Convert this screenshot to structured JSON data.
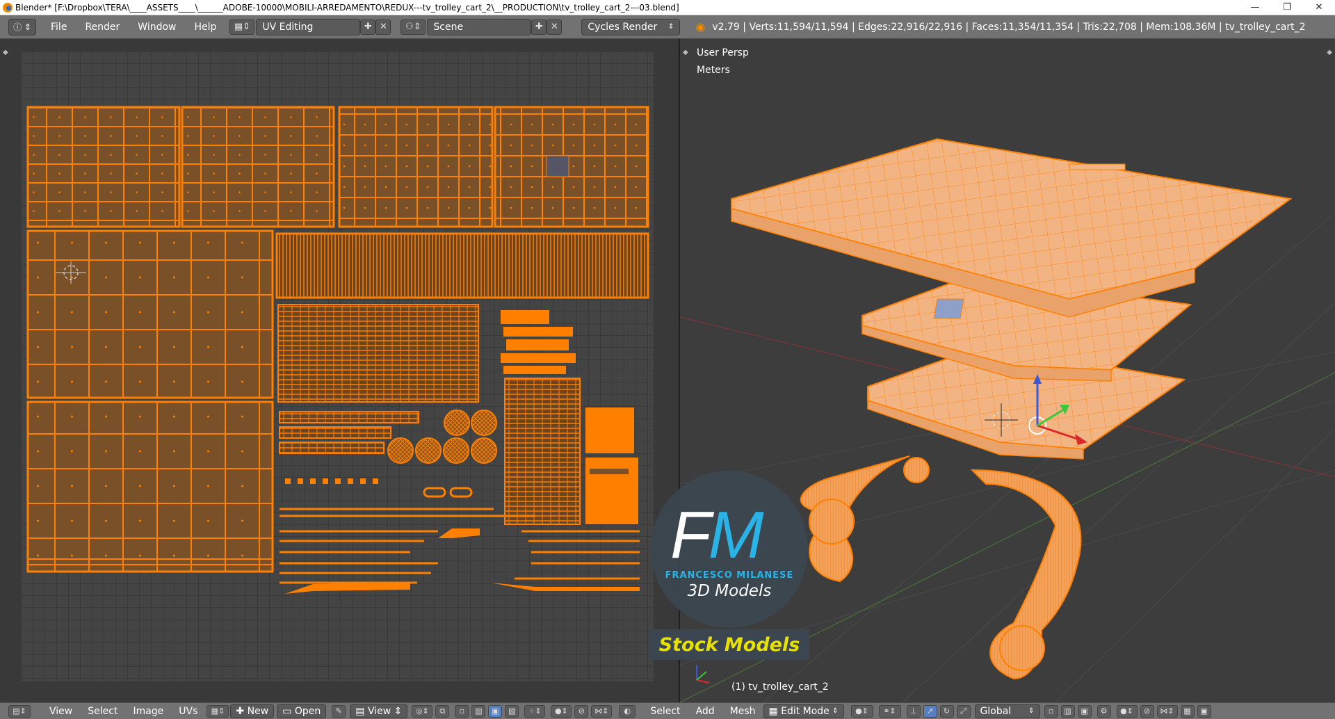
{
  "titlebar": {
    "title": "Blender* [F:\\Dropbox\\TERA\\____ASSETS____\\______ADOBE-10000\\MOBILI-ARREDAMENTO\\REDUX---tv_trolley_cart_2\\__PRODUCTION\\tv_trolley_cart_2---03.blend]",
    "minimize": "—",
    "maximize": "❐",
    "close": "✕"
  },
  "header": {
    "menus": [
      "File",
      "Render",
      "Window",
      "Help"
    ],
    "screen_layout": "UV Editing",
    "scene": "Scene",
    "render_engine": "Cycles Render",
    "stats": "v2.79 | Verts:11,594/11,594 | Edges:22,916/22,916 | Faces:11,354/11,354 | Tris:22,708 | Mem:108.36M | tv_trolley_cart_2"
  },
  "viewport": {
    "view_name": "User Persp",
    "units": "Meters",
    "object_label": "(1) tv_trolley_cart_2"
  },
  "watermark": {
    "logo_text": "FM",
    "name": "FRANCESCO MILANESE",
    "subtitle": "3D Models",
    "banner": "Stock Models"
  },
  "uv_footer": {
    "menus": [
      "View",
      "Select",
      "Image",
      "UVs"
    ],
    "new_label": "New",
    "open_label": "Open",
    "view_label": "View"
  },
  "view3d_footer": {
    "menus": [
      "Select",
      "Add",
      "Mesh"
    ],
    "mode": "Edit Mode",
    "orientation": "Global"
  },
  "colors": {
    "uv_orange": "#ff8000",
    "island_fill": "#7a5028",
    "mesh_fill": "#f0b080",
    "header_bg": "#727272"
  }
}
